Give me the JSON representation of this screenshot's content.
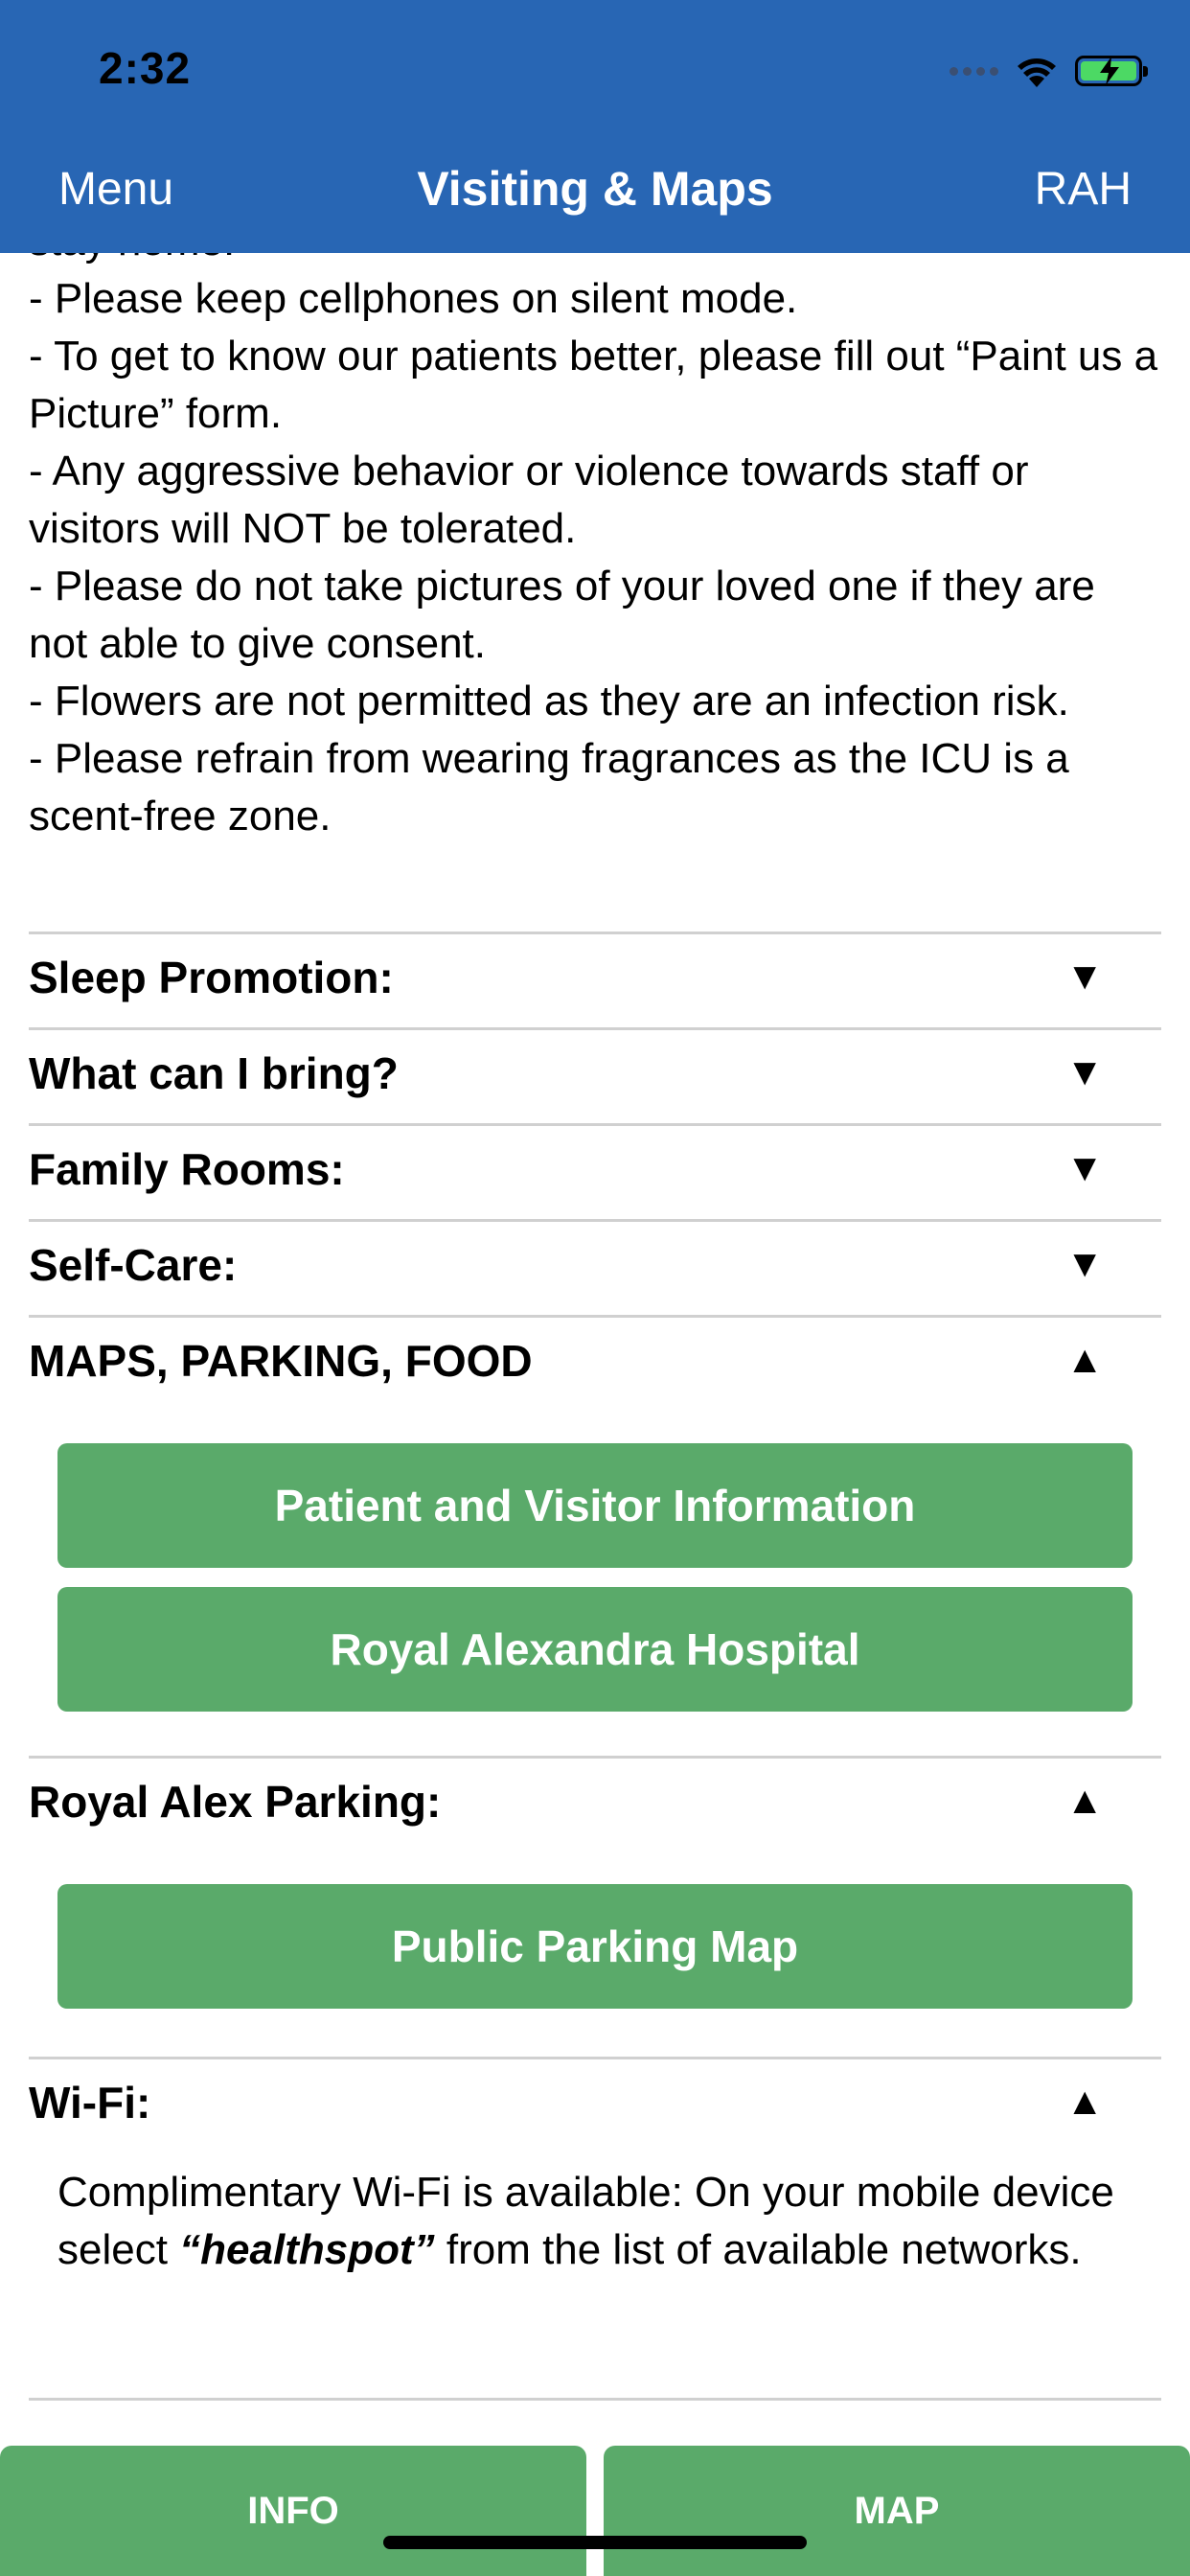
{
  "status_bar": {
    "time": "2:32"
  },
  "nav": {
    "left": "Menu",
    "title": "Visiting & Maps",
    "right": "RAH"
  },
  "rules": [
    "stay home.",
    "- Please keep cellphones on silent mode.",
    "- To get to know our patients better, please fill out “Paint us a Picture” form.",
    "- Any aggressive behavior or violence towards staff or visitors will NOT be tolerated.",
    "- Please do not take pictures of your loved one if they are not able to give consent.",
    "- Flowers are not permitted as they are an infection risk.",
    "- Please refrain from wearing fragrances as the ICU is a scent-free zone."
  ],
  "sections": {
    "sleep": {
      "label": "Sleep Promotion:",
      "arrow": "▼"
    },
    "bring": {
      "label": "What can I bring?",
      "arrow": "▼"
    },
    "family": {
      "label": "Family Rooms:",
      "arrow": "▼"
    },
    "selfcare": {
      "label": "Self-Care:",
      "arrow": "▼"
    },
    "maps": {
      "label": "MAPS, PARKING, FOOD",
      "arrow": "▲",
      "buttons": [
        "Patient and Visitor Information",
        "Royal Alexandra Hospital"
      ]
    },
    "parking": {
      "label": "Royal Alex Parking:",
      "arrow": "▲",
      "buttons": [
        "Public Parking Map"
      ]
    },
    "wifi": {
      "label": "Wi-Fi:",
      "arrow": "▲",
      "text_before": "Complimentary Wi-Fi is available: On your mobile device select ",
      "network": "“healthspot”",
      "text_after": " from the list of available networks."
    }
  },
  "tabs": {
    "info": "INFO",
    "map": "MAP"
  },
  "colors": {
    "header": "#2866b4",
    "button": "#5aaa6a",
    "divider": "#d0d0d0"
  }
}
